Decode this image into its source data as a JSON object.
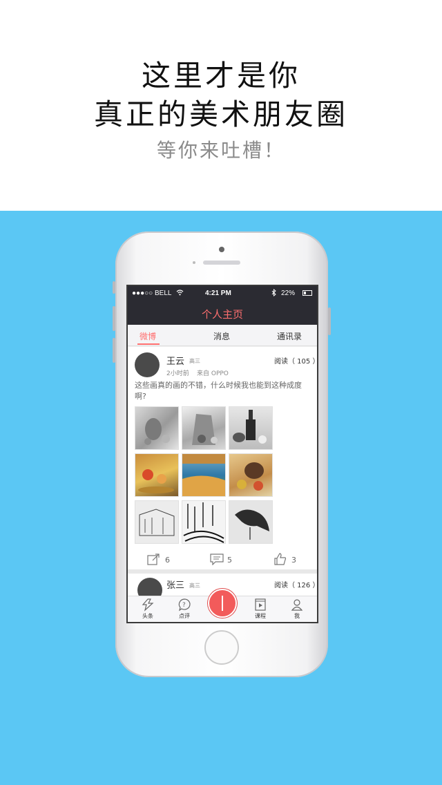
{
  "promo": {
    "line1": "这里才是你",
    "line2": "真正的美术朋友圈",
    "line3": "等你来吐槽！"
  },
  "status_bar": {
    "carrier": "●●●○○ BELL",
    "time": "4:21 PM",
    "battery": "22%"
  },
  "nav": {
    "title": "个人主页"
  },
  "tabs": [
    {
      "label": "微博",
      "active": true
    },
    {
      "label": "消息",
      "active": false
    },
    {
      "label": "通讯录",
      "active": false
    }
  ],
  "post": {
    "author": "王云",
    "grade": "高三",
    "reads": "阅读（ 105 ）",
    "time": "2小时前",
    "source": "来自 OPPO",
    "text": "这些画真的画的不错，什么时候我也能到这种成度啊?",
    "images": [
      "sketch-vase-fruit",
      "sketch-cloth-jar",
      "sketch-wine-bottle",
      "painting-fruit-table",
      "painting-landscape-lake",
      "painting-still-life-pot",
      "sketch-old-building",
      "sketch-street-lines",
      "sketch-crow"
    ],
    "share_count": "6",
    "comment_count": "5",
    "like_count": "3"
  },
  "post2": {
    "author": "张三",
    "grade": "高三",
    "reads": "阅读（ 126 ）"
  },
  "tabbar": {
    "items": [
      {
        "label": "头条",
        "icon": "headline-icon"
      },
      {
        "label": "点评",
        "icon": "question-bubble-icon"
      },
      {
        "label": "课程",
        "icon": "video-course-icon"
      },
      {
        "label": "我",
        "icon": "person-icon"
      }
    ]
  },
  "colors": {
    "accent": "#ff6f6f",
    "background_blue": "#5bc7f4",
    "navbar": "#2b2b32"
  }
}
